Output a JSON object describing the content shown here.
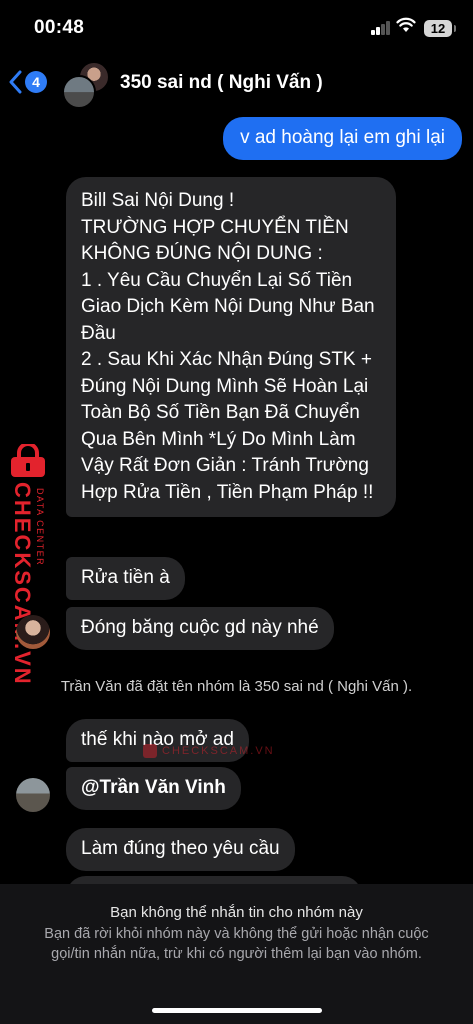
{
  "status_bar": {
    "time": "00:48",
    "battery": "12"
  },
  "header": {
    "back_count": "4",
    "title": "350 sai nd ( Nghi Vấn )"
  },
  "messages": {
    "outgoing_1": "v ad hoàng lại em ghi lại",
    "incoming_long": "Bill Sai Nội Dung !\nTRƯỜNG HỢP CHUYỂN TIỀN KHÔNG ĐÚNG NỘI DUNG :\n1 . Yêu Cầu Chuyển Lại Số Tiền Giao Dịch Kèm Nội Dung Như Ban Đầu\n2 . Sau Khi Xác Nhận Đúng STK + Đúng Nội Dung Mình Sẽ Hoàn Lại Toàn Bộ Số Tiền Bạn Đã Chuyển Qua Bên Mình  *Lý Do Mình Làm Vậy Rất Đơn Giản : Tránh Trường Hợp Rửa Tiền , Tiền Phạm Pháp !!",
    "incoming_rua": "Rửa tiền à",
    "incoming_dong": "Đóng băng cuộc gd này nhé",
    "incoming_the": "thế khi nào mở ad",
    "incoming_mention": "@Trần Văn Vinh",
    "incoming_lam": "Làm đúng theo yêu cầu"
  },
  "system_message": "Trần Văn đã đặt tên nhóm là 350 sai nd ( Nghi Vấn ).",
  "watermark": {
    "brand": "CHECKSCAM.VN",
    "sub": "DATA CENTER",
    "center": "CHECKSCAM.VN"
  },
  "bottom_notice": {
    "title": "Bạn không thể nhắn tin cho nhóm này",
    "description": "Bạn đã rời khỏi nhóm này và không thể gửi hoặc nhận cuộc gọi/tin nhắn nữa, trừ khi có người thêm lại bạn vào nhóm."
  },
  "colors": {
    "accent": "#1f6ff2",
    "incoming_bubble": "#262628",
    "watermark": "#e3232d",
    "badge": "#2f7cf6"
  },
  "icons": [
    "back-chevron-icon",
    "signal-icon",
    "wifi-icon",
    "battery-icon",
    "lock-icon"
  ]
}
